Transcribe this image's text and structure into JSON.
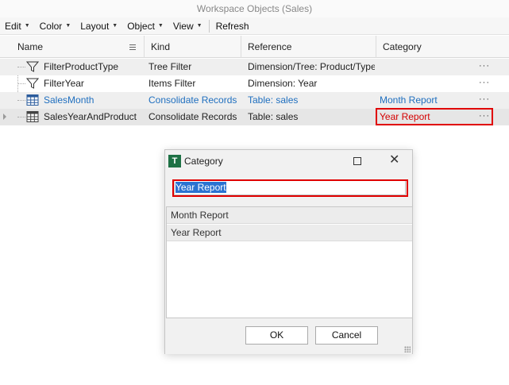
{
  "window": {
    "title": "Workspace Objects (Sales)"
  },
  "menu": {
    "items": [
      {
        "label": "Edit",
        "has_arrow": true
      },
      {
        "label": "Color",
        "has_arrow": true
      },
      {
        "label": "Layout",
        "has_arrow": true
      },
      {
        "label": "Object",
        "has_arrow": true
      },
      {
        "label": "View",
        "has_arrow": true
      },
      {
        "label": "Refresh",
        "has_arrow": false
      }
    ]
  },
  "grid": {
    "columns": [
      "Name",
      "Kind",
      "Reference",
      "Category"
    ],
    "rows": [
      {
        "name": "FilterProductType",
        "kind": "Tree Filter",
        "reference": "Dimension/Tree: Product/Type",
        "category": "",
        "icon": "filter-icon"
      },
      {
        "name": "FilterYear",
        "kind": "Items Filter",
        "reference": "Dimension: Year",
        "category": "",
        "icon": "filter-icon"
      },
      {
        "name": "SalesMonth",
        "kind": "Consolidate Records",
        "reference": "Table: sales",
        "category": "Month Report",
        "icon": "table-icon"
      },
      {
        "name": "SalesYearAndProduct",
        "kind": "Consolidate Records",
        "reference": "Table: sales",
        "category": "Year Report",
        "icon": "table-icon"
      }
    ],
    "ellipsis": "···"
  },
  "dialog": {
    "title": "Category",
    "logo_letter": "T",
    "input_value": "Year Report",
    "list": [
      "Month Report",
      "Year Report"
    ],
    "ok_label": "OK",
    "cancel_label": "Cancel",
    "close_glyph": "✕"
  },
  "colors": {
    "link_blue": "#1f6fbf",
    "highlight_red": "#e00000",
    "logo_green": "#1e7145",
    "selection_blue": "#2b73d1"
  }
}
